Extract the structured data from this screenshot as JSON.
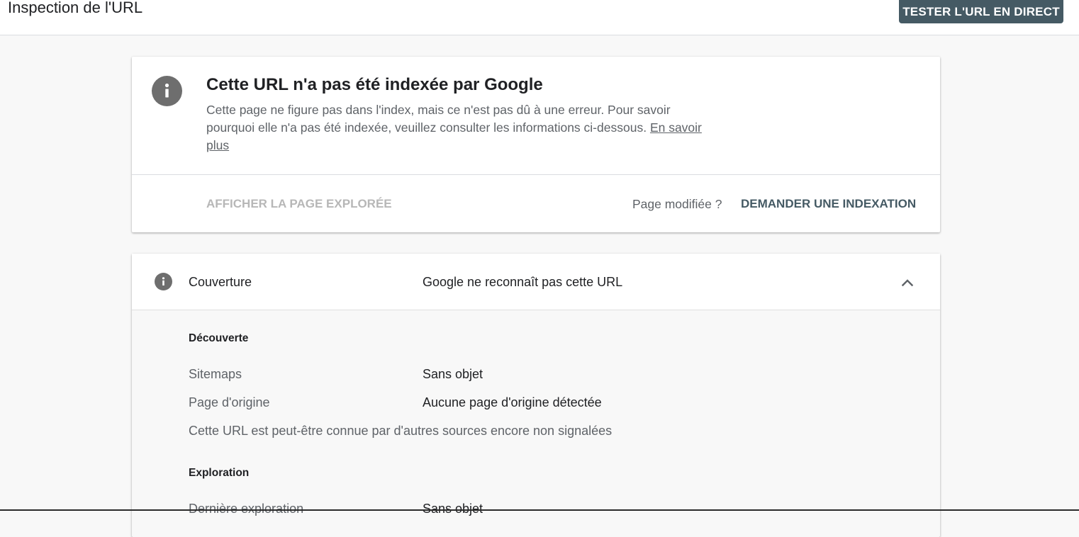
{
  "header": {
    "title": "Inspection de l'URL",
    "live_test_label": "TESTER L'URL EN DIRECT"
  },
  "status_card": {
    "icon": "info-icon",
    "heading": "Cette URL n'a pas été indexée par Google",
    "description": "Cette page ne figure pas dans l'index, mais ce n'est pas dû à une erreur. Pour savoir pourquoi elle n'a pas été indexée, veuillez consulter les informations ci-dessous.",
    "learn_more": "En savoir plus",
    "view_crawled_label": "AFFICHER LA PAGE EXPLORÉE",
    "page_modified_label": "Page modifiée ?",
    "request_indexing_label": "DEMANDER UNE INDEXATION"
  },
  "coverage": {
    "icon": "info-icon",
    "label": "Couverture",
    "status": "Google ne reconnaît pas cette URL",
    "toggle_icon": "chevron-up-icon",
    "discovery": {
      "title": "Découverte",
      "rows": [
        {
          "label": "Sitemaps",
          "value": "Sans objet"
        },
        {
          "label": "Page d'origine",
          "value": "Aucune page d'origine détectée"
        }
      ],
      "note": "Cette URL est peut-être connue par d'autres sources encore non signalées"
    },
    "crawl": {
      "title": "Exploration",
      "rows": [
        {
          "label": "Dernière exploration",
          "value": "Sans objet"
        }
      ]
    }
  },
  "colors": {
    "accent": "#455a64",
    "icon_gray": "#6e6e6e",
    "disabled_text": "#b7b7b7",
    "secondary_text": "#5f6368"
  }
}
